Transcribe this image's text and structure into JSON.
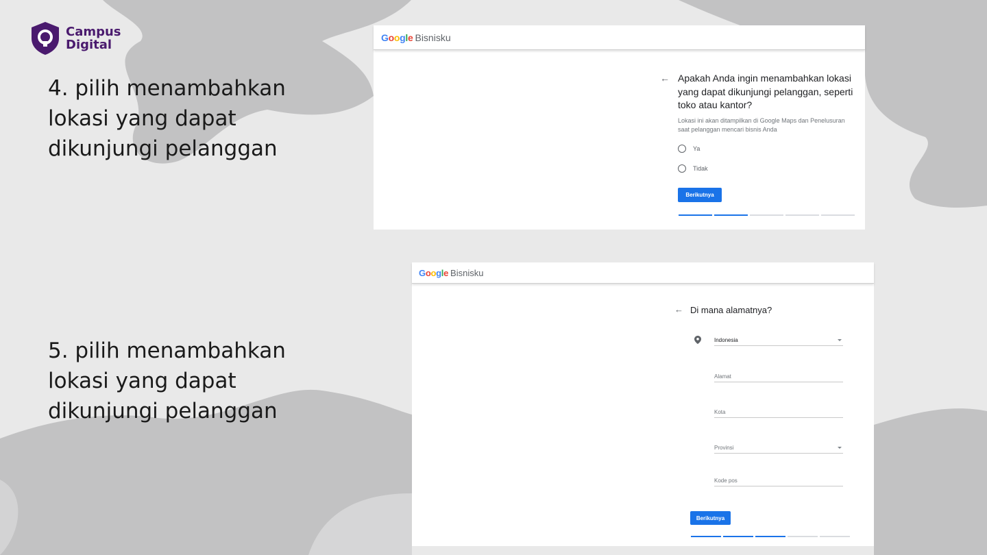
{
  "logo": {
    "line1": "Campus",
    "line2": "Digital"
  },
  "steps": {
    "step4": "4. pilih menambahkan lokasi yang dapat dikunjungi pelanggan",
    "step5": "5. pilih menambahkan lokasi yang dapat dikunjungi pelanggan"
  },
  "google_bar": {
    "g1": "G",
    "g2": "o",
    "g3": "o",
    "g4": "g",
    "g5": "l",
    "g6": "e",
    "product": "Bisnisku"
  },
  "screen1": {
    "back_icon": "←",
    "question": "Apakah Anda ingin menambahkan lokasi yang dapat dikunjungi pelanggan, seperti toko atau kantor?",
    "subtitle": "Lokasi ini akan ditampilkan di Google Maps dan Penelusuran saat pelanggan mencari bisnis Anda",
    "options": [
      "Ya",
      "Tidak"
    ],
    "next_label": "Berikutnya",
    "progress": {
      "done": 2,
      "total": 5
    }
  },
  "screen2": {
    "back_icon": "←",
    "question": "Di mana alamatnya?",
    "country_value": "Indonesia",
    "address_placeholder": "Alamat",
    "city_placeholder": "Kota",
    "province_placeholder": "Provinsi",
    "postal_placeholder": "Kode pos",
    "next_label": "Berikutnya",
    "progress": {
      "done": 3,
      "total": 5
    }
  },
  "colors": {
    "accent": "#1a73e8",
    "brand": "#4a1a6e",
    "background": "#e9e9e9",
    "blob": "#bdbdbd"
  },
  "icons": {
    "logo": "lightbulb-shield-icon",
    "back": "arrow-left-icon",
    "pin": "location-pin-icon",
    "dropdown": "caret-down-icon"
  }
}
